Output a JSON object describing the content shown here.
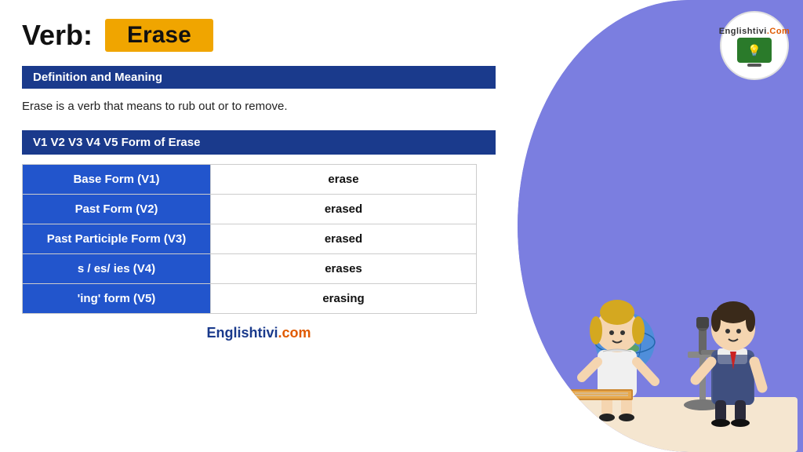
{
  "page": {
    "verb_label": "Verb:",
    "verb_word": "Erase",
    "definition_header": "Definition and Meaning",
    "definition_text": "Erase is a verb that means to rub out or to remove.",
    "forms_header": "V1 V2 V3 V4 V5 Form of Erase",
    "table_rows": [
      {
        "label": "Base Form (V1)",
        "value": "erase"
      },
      {
        "label": "Past Form (V2)",
        "value": "erased"
      },
      {
        "label": "Past Participle Form (V3)",
        "value": "erased"
      },
      {
        "label": "s / es/ ies (V4)",
        "value": "erases"
      },
      {
        "label": "'ing' form (V5)",
        "value": "erasing"
      }
    ],
    "footer_text1": "Englishtivi",
    "footer_text2": ".com",
    "logo_line1": "Englishtivi",
    "logo_line2": ".Com"
  }
}
